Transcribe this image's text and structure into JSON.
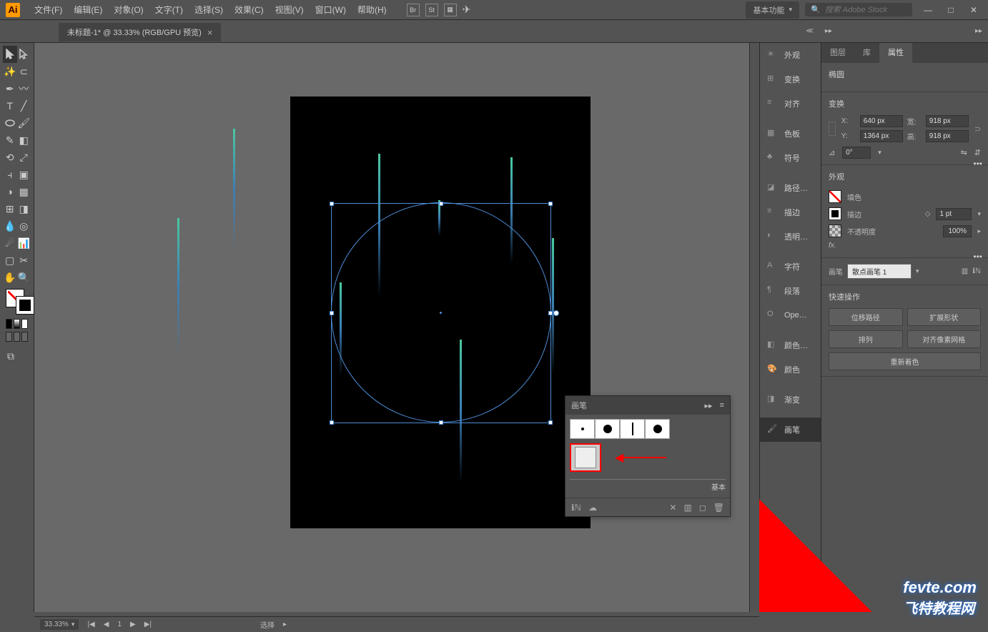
{
  "app": {
    "logo": "Ai"
  },
  "menu": {
    "file": "文件(F)",
    "edit": "编辑(E)",
    "object": "对象(O)",
    "type": "文字(T)",
    "select": "选择(S)",
    "effect": "效果(C)",
    "view": "视图(V)",
    "window": "窗口(W)",
    "help": "帮助(H)"
  },
  "topIcons": {
    "br": "Br",
    "st": "St"
  },
  "workspace": {
    "label": "基本功能"
  },
  "search": {
    "placeholder": "搜索 Adobe Stock"
  },
  "winBtns": {
    "min": "—",
    "max": "□",
    "close": "✕"
  },
  "tab": {
    "title": "未标题-1* @ 33.33% (RGB/GPU 预览)",
    "close": "×"
  },
  "collapsed": {
    "appearance": "外观",
    "transform": "变换",
    "align": "对齐",
    "swatches": "色板",
    "symbols": "符号",
    "pathfinder": "路径…",
    "stroke": "描边",
    "transparency": "透明…",
    "character": "字符",
    "paragraph": "段落",
    "opentype": "Ope…",
    "color": "颜色…",
    "color2": "颜色",
    "gradient": "渐变",
    "brushes": "画笔"
  },
  "panelTabs": {
    "layers": "图层",
    "libraries": "库",
    "properties": "属性"
  },
  "props": {
    "shapeTitle": "椭圆",
    "transformTitle": "变换",
    "x": "640 px",
    "y": "1364 px",
    "w": "918 px",
    "h": "918 px",
    "xlabel": "X:",
    "ylabel": "Y:",
    "wlabel": "宽:",
    "hlabel": "高:",
    "angle": "0°",
    "appearanceTitle": "外观",
    "fill": "填色",
    "stroke": "描边",
    "strokeVal": "1 pt",
    "opacity": "不透明度",
    "opacityVal": "100%",
    "fx": "fx.",
    "brushLabel": "画笔",
    "brushName": "散点画笔 1",
    "quickTitle": "快速操作",
    "offset": "位移路径",
    "expand": "扩展形状",
    "arrange": "排列",
    "pixelAlign": "对齐像素网格",
    "recolor": "重新着色"
  },
  "floatPanel": {
    "title": "画笔",
    "basic": "基本"
  },
  "status": {
    "zoom": "33.33%",
    "page": "1",
    "tool": "选择"
  },
  "watermark": {
    "url": "fevte.com",
    "cn": "飞特教程网"
  }
}
